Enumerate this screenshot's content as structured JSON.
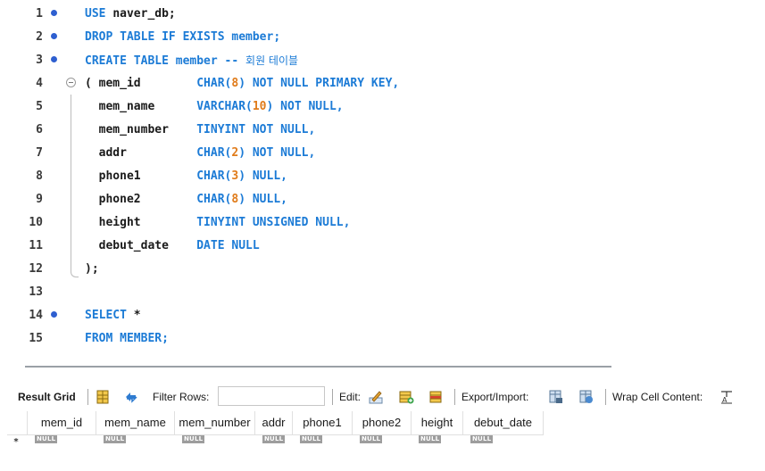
{
  "editor": {
    "lines": [
      {
        "n": "1",
        "dot": true,
        "parts": [
          {
            "t": "USE ",
            "c": "kw"
          },
          {
            "t": "naver_db;",
            "c": ""
          }
        ]
      },
      {
        "n": "2",
        "dot": true,
        "parts": [
          {
            "t": "DROP TABLE IF EXISTS ",
            "c": "kw"
          },
          {
            "t": "member;",
            "c": "kw"
          }
        ]
      },
      {
        "n": "3",
        "dot": true,
        "parts": [
          {
            "t": "CREATE TABLE ",
            "c": "kw"
          },
          {
            "t": "member ",
            "c": "kw"
          },
          {
            "t": "-- ",
            "c": "kw"
          },
          {
            "t": "회원 테이블",
            "c": "cmt"
          }
        ]
      },
      {
        "n": "4",
        "dot": false,
        "fold": true,
        "parts": [
          {
            "t": "( mem_id        ",
            "c": ""
          },
          {
            "t": "CHAR(",
            "c": "kw"
          },
          {
            "t": "8",
            "c": "num"
          },
          {
            "t": ") NOT NULL PRIMARY KEY,",
            "c": "kw"
          }
        ]
      },
      {
        "n": "5",
        "dot": false,
        "parts": [
          {
            "t": "  mem_name      ",
            "c": ""
          },
          {
            "t": "VARCHAR(",
            "c": "kw"
          },
          {
            "t": "10",
            "c": "num"
          },
          {
            "t": ") NOT NULL,",
            "c": "kw"
          }
        ]
      },
      {
        "n": "6",
        "dot": false,
        "parts": [
          {
            "t": "  mem_number    ",
            "c": ""
          },
          {
            "t": "TINYINT NOT NULL,",
            "c": "kw"
          }
        ]
      },
      {
        "n": "7",
        "dot": false,
        "parts": [
          {
            "t": "  addr          ",
            "c": ""
          },
          {
            "t": "CHAR(",
            "c": "kw"
          },
          {
            "t": "2",
            "c": "num"
          },
          {
            "t": ") NOT NULL,",
            "c": "kw"
          }
        ]
      },
      {
        "n": "8",
        "dot": false,
        "parts": [
          {
            "t": "  phone1        ",
            "c": ""
          },
          {
            "t": "CHAR(",
            "c": "kw"
          },
          {
            "t": "3",
            "c": "num"
          },
          {
            "t": ") NULL,",
            "c": "kw"
          }
        ]
      },
      {
        "n": "9",
        "dot": false,
        "parts": [
          {
            "t": "  phone2        ",
            "c": ""
          },
          {
            "t": "CHAR(",
            "c": "kw"
          },
          {
            "t": "8",
            "c": "num"
          },
          {
            "t": ") NULL,",
            "c": "kw"
          }
        ]
      },
      {
        "n": "10",
        "dot": false,
        "parts": [
          {
            "t": "  height        ",
            "c": ""
          },
          {
            "t": "TINYINT UNSIGNED NULL,",
            "c": "kw"
          }
        ]
      },
      {
        "n": "11",
        "dot": false,
        "parts": [
          {
            "t": "  debut_date    ",
            "c": ""
          },
          {
            "t": "DATE NULL",
            "c": "kw"
          }
        ]
      },
      {
        "n": "12",
        "dot": false,
        "parts": [
          {
            "t": ");",
            "c": ""
          }
        ]
      },
      {
        "n": "13",
        "dot": false,
        "parts": []
      },
      {
        "n": "14",
        "dot": true,
        "parts": [
          {
            "t": "SELECT ",
            "c": "kw"
          },
          {
            "t": "*",
            "c": ""
          }
        ]
      },
      {
        "n": "15",
        "dot": false,
        "parts": [
          {
            "t": "FROM ",
            "c": "kw"
          },
          {
            "t": "MEMBER;",
            "c": "kw"
          }
        ]
      }
    ]
  },
  "toolbar": {
    "result_grid": "Result Grid",
    "filter_rows": "Filter Rows:",
    "filter_value": "",
    "edit": "Edit:",
    "export_import": "Export/Import:",
    "wrap_cell": "Wrap Cell Content:"
  },
  "grid": {
    "columns": [
      "mem_id",
      "mem_name",
      "mem_number",
      "addr",
      "phone1",
      "phone2",
      "height",
      "debut_date"
    ],
    "null_label": "NULL",
    "new_row_marker": "*"
  },
  "colors": {
    "keyword": "#1c7bd6",
    "number": "#e07b1a",
    "breakpoint": "#2e5fd0"
  }
}
